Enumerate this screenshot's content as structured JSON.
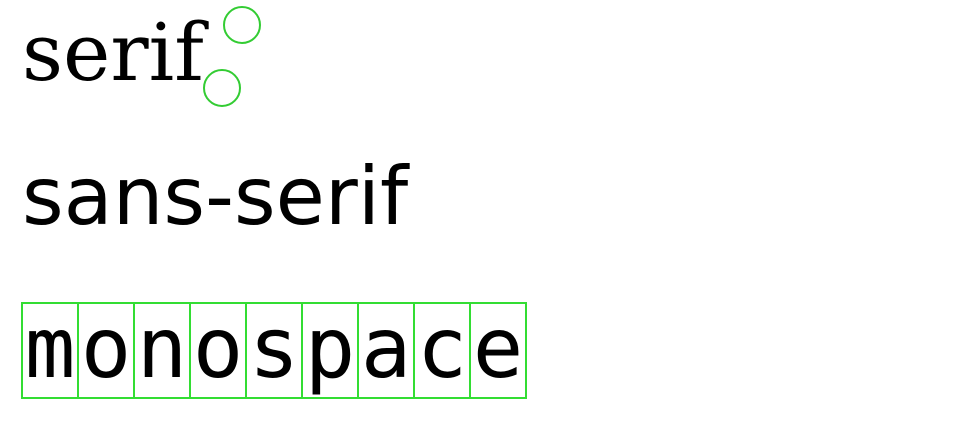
{
  "samples": {
    "serif": "serif",
    "sans_serif": "sans-serif",
    "monospace_letters": [
      "m",
      "o",
      "n",
      "o",
      "s",
      "p",
      "a",
      "c",
      "e"
    ]
  },
  "colors": {
    "text": "#000000",
    "highlight": "#33dd33",
    "background": "#ffffff"
  }
}
